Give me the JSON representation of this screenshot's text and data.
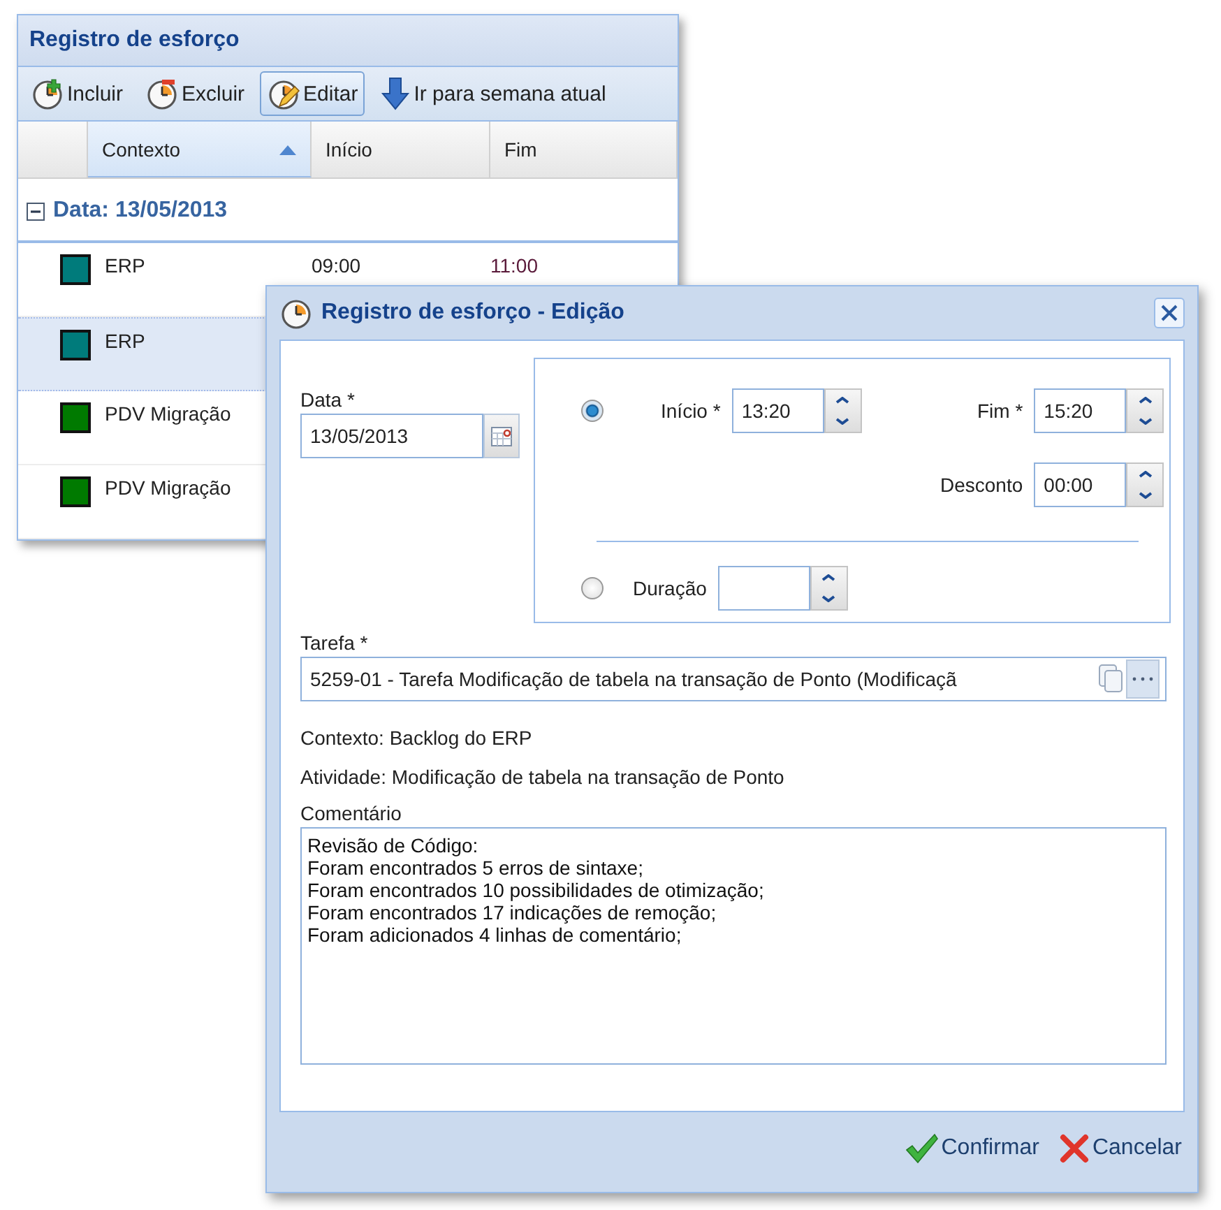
{
  "list_window": {
    "title": "Registro de esforço",
    "toolbar": [
      {
        "label": "Incluir",
        "kind": "add",
        "pressed": false
      },
      {
        "label": "Excluir",
        "kind": "remove",
        "pressed": false
      },
      {
        "label": "Editar",
        "kind": "edit",
        "pressed": true
      },
      {
        "label": "Ir para semana atual",
        "kind": "down",
        "pressed": false
      }
    ],
    "columns": [
      {
        "label": "Contexto",
        "sorted": true
      },
      {
        "label": "Início",
        "sorted": false
      },
      {
        "label": "Fim",
        "sorted": false
      }
    ],
    "group": {
      "label": "Data: 13/05/2013",
      "expanded": true
    },
    "rows": [
      {
        "context": "ERP",
        "color": "#007b7b",
        "start": "09:00",
        "end": "11:00",
        "selected": false
      },
      {
        "context": "ERP",
        "color": "#007b7b",
        "selected": true
      },
      {
        "context": "PDV Migração",
        "color": "#007a00",
        "selected": false
      },
      {
        "context": "PDV Migração",
        "color": "#007a00",
        "selected": false
      }
    ]
  },
  "dialog": {
    "title": "Registro de esforço - Edição",
    "date": {
      "label": "Data *",
      "value": "13/05/2013"
    },
    "range": {
      "selected": true,
      "start": {
        "label": "Início *",
        "value": "13:20"
      },
      "end": {
        "label": "Fim *",
        "value": "15:20"
      },
      "discount": {
        "label": "Desconto",
        "value": "00:00"
      }
    },
    "duration": {
      "selected": false,
      "label": "Duração"
    },
    "task": {
      "label": "Tarefa *",
      "value": "5259-01 - Tarefa Modificação de tabela na transação de Ponto (Modificaçã"
    },
    "info": [
      "Contexto: Backlog do ERP",
      "Atividade: Modificação de tabela na transação de Ponto"
    ],
    "comment": {
      "label": "Comentário",
      "lines": [
        "Revisão de Código:",
        "Foram encontrados 5 erros de sintaxe;",
        "Foram encontrados 10 possibilidades de otimização;",
        "Foram encontrados 17 indicações de remoção;",
        "Foram adicionados 4 linhas de comentário;"
      ]
    },
    "buttons": [
      {
        "label": "Confirmar",
        "kind": "confirm"
      },
      {
        "label": "Cancelar",
        "kind": "cancel"
      }
    ]
  }
}
